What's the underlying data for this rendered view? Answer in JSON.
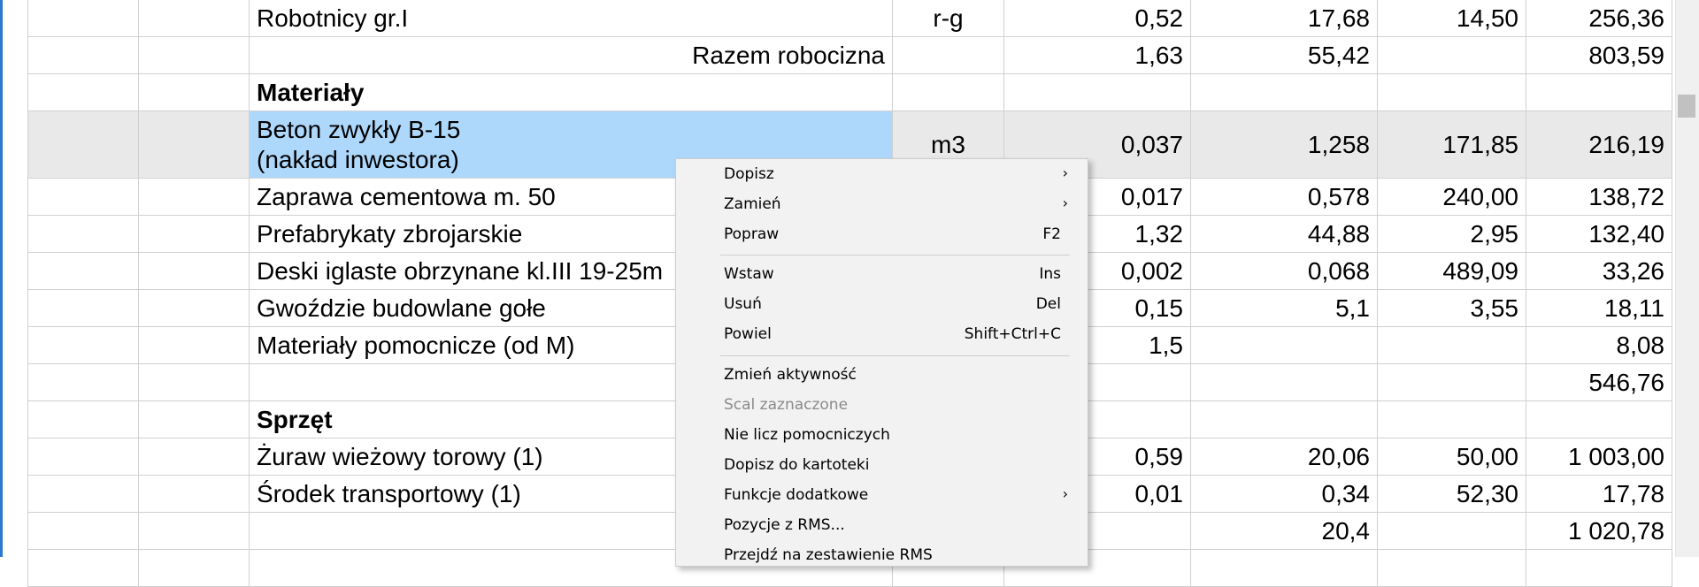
{
  "rows": [
    {
      "name": "Robotnicy gr.I",
      "unit": "r-g",
      "n1": "0,52",
      "n2": "17,68",
      "price": "14,50",
      "total": "256,36"
    },
    {
      "name": "Razem robocizna",
      "unit": "",
      "n1": "1,63",
      "n2": "55,42",
      "price": "",
      "total": "803,59"
    },
    {
      "name": "Materiały",
      "unit": "",
      "n1": "",
      "n2": "",
      "price": "",
      "total": ""
    },
    {
      "name_line1": "Beton zwykły B-15",
      "name_line2": "(nakład inwestora)",
      "unit": "m3",
      "n1": "0,037",
      "n2": "1,258",
      "price": "171,85",
      "total": "216,19"
    },
    {
      "name": "Zaprawa cementowa m. 50",
      "unit": "",
      "n1": "0,017",
      "n2": "0,578",
      "price": "240,00",
      "total": "138,72"
    },
    {
      "name": "Prefabrykaty zbrojarskie",
      "unit": "",
      "n1": "1,32",
      "n2": "44,88",
      "price": "2,95",
      "total": "132,40"
    },
    {
      "name": "Deski iglaste obrzynane kl.III 19-25m",
      "unit": "",
      "n1": "0,002",
      "n2": "0,068",
      "price": "489,09",
      "total": "33,26"
    },
    {
      "name": "Gwoździe budowlane gołe",
      "unit": "",
      "n1": "0,15",
      "n2": "5,1",
      "price": "3,55",
      "total": "18,11"
    },
    {
      "name": "Materiały pomocnicze (od M)",
      "unit": "",
      "n1": "1,5",
      "n2": "",
      "price": "",
      "total": "8,08"
    },
    {
      "name": "",
      "unit": "",
      "n1": "",
      "n2": "",
      "price": "",
      "total": "546,76"
    },
    {
      "name": "Sprzęt",
      "unit": "",
      "n1": "",
      "n2": "",
      "price": "",
      "total": ""
    },
    {
      "name": "Żuraw wieżowy torowy (1)",
      "unit": "",
      "n1": "0,59",
      "n2": "20,06",
      "price": "50,00",
      "total": "1 003,00"
    },
    {
      "name": "Środek transportowy (1)",
      "unit": "",
      "n1": "0,01",
      "n2": "0,34",
      "price": "52,30",
      "total": "17,78"
    },
    {
      "name": "",
      "unit": "",
      "n1": "",
      "n2": "20,4",
      "price": "",
      "total": "1 020,78"
    }
  ],
  "context_menu": {
    "items": [
      {
        "label": "Dopisz",
        "shortcut": "",
        "submenu": true,
        "disabled": false
      },
      {
        "label": "Zamień",
        "shortcut": "",
        "submenu": true,
        "disabled": false
      },
      {
        "label": "Popraw",
        "shortcut": "F2",
        "submenu": false,
        "disabled": false
      },
      {
        "label": "Wstaw",
        "shortcut": "Ins",
        "submenu": false,
        "disabled": false
      },
      {
        "label": "Usuń",
        "shortcut": "Del",
        "submenu": false,
        "disabled": false
      },
      {
        "label": "Powiel",
        "shortcut": "Shift+Ctrl+C",
        "submenu": false,
        "disabled": false
      },
      {
        "label": "Zmień aktywność",
        "shortcut": "",
        "submenu": false,
        "disabled": false
      },
      {
        "label": "Scal zaznaczone",
        "shortcut": "",
        "submenu": false,
        "disabled": true
      },
      {
        "label": "Nie licz pomocniczych",
        "shortcut": "",
        "submenu": false,
        "disabled": false
      },
      {
        "label": "Dopisz do kartoteki",
        "shortcut": "",
        "submenu": false,
        "disabled": false
      },
      {
        "label": "Funkcje dodatkowe",
        "shortcut": "",
        "submenu": true,
        "disabled": false
      },
      {
        "label": "Pozycje z RMS...",
        "shortcut": "",
        "submenu": false,
        "disabled": false
      },
      {
        "label": "Przejdź na zestawienie RMS",
        "shortcut": "",
        "submenu": false,
        "disabled": false
      }
    ],
    "submenu_arrow": "›"
  },
  "colors": {
    "section_heading": "#0b0ba8",
    "selection": "#aed8fb",
    "selected_row": "#e9e9e9",
    "total_text": "#9a9a9a"
  }
}
